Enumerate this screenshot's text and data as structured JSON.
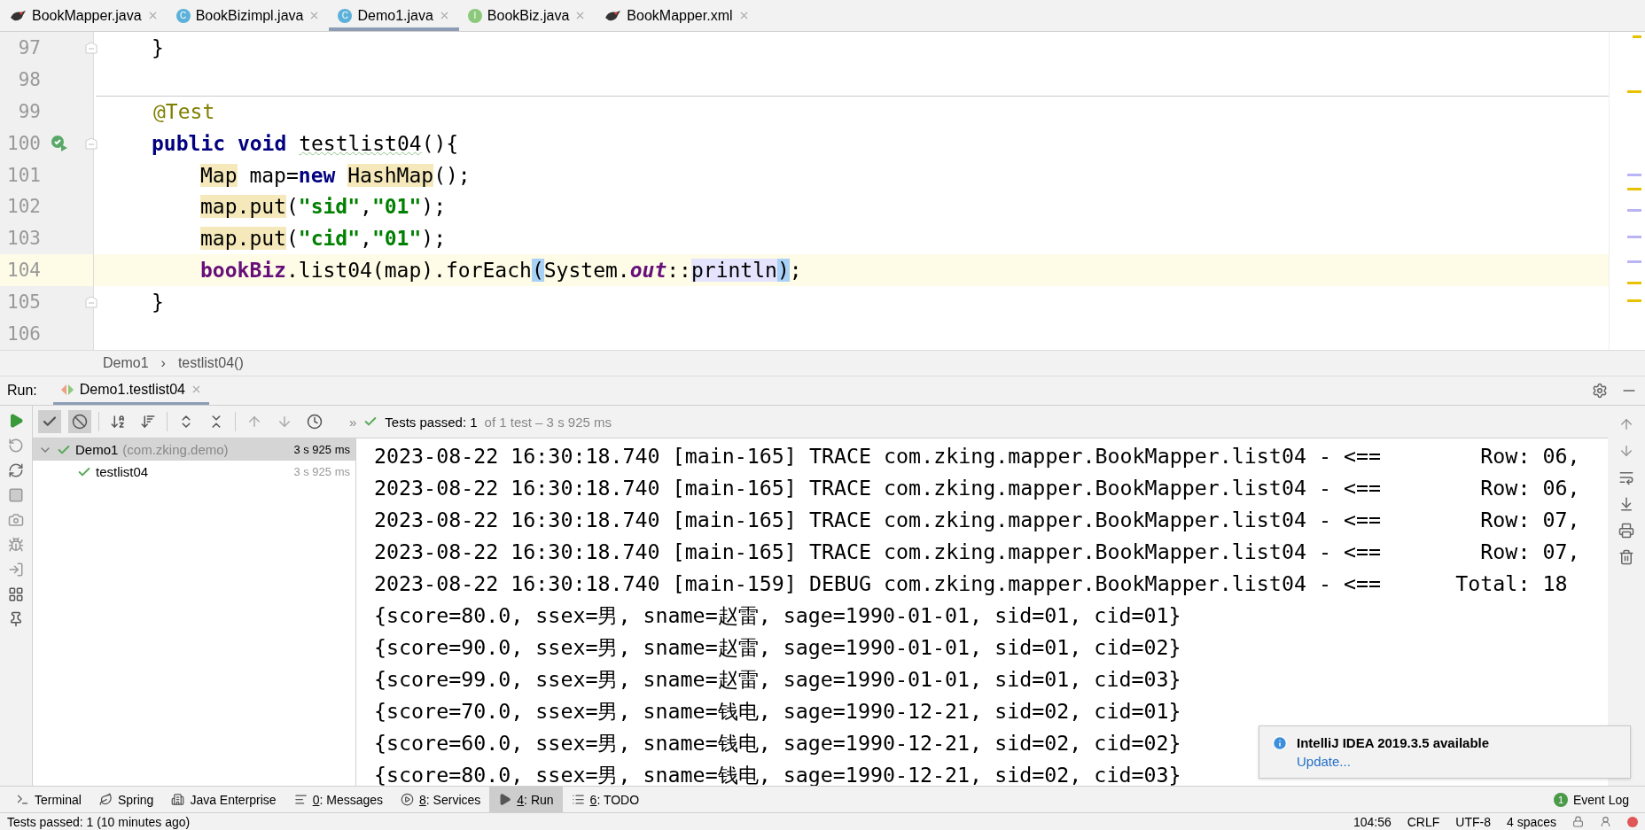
{
  "editor_tabs": [
    {
      "label": "BookMapper.java",
      "kind": "mybatis",
      "selected": false
    },
    {
      "label": "BookBizimpl.java",
      "kind": "class",
      "badge": "C",
      "selected": false
    },
    {
      "label": "Demo1.java",
      "kind": "test_class",
      "badge": "C",
      "selected": true
    },
    {
      "label": "BookBiz.java",
      "kind": "interface",
      "badge": "I",
      "selected": false
    },
    {
      "label": "BookMapper.xml",
      "kind": "mybatis",
      "selected": false
    }
  ],
  "code_lines": [
    {
      "number": "97",
      "kind": "member",
      "fold": true,
      "runnable": false,
      "separator": false,
      "current": false,
      "tokens": [
        {
          "text": "}",
          "kind": "plain"
        }
      ]
    },
    {
      "number": "98",
      "kind": "member",
      "fold": false,
      "runnable": false,
      "separator": false,
      "current": false
    },
    {
      "number": "99",
      "kind": "member",
      "fold": false,
      "runnable": false,
      "separator": true,
      "current": false,
      "tokens": [
        {
          "text": "@Test",
          "kind": "annotation"
        }
      ]
    },
    {
      "number": "100",
      "kind": "member",
      "fold": true,
      "runnable": true,
      "separator": false,
      "current": false,
      "tokens": [
        {
          "text": "public void ",
          "kind": "keyword"
        },
        {
          "text": "testlist04",
          "kind": "warn"
        },
        {
          "text": "(){",
          "kind": "plain"
        }
      ]
    },
    {
      "number": "101",
      "kind": "statement",
      "fold": false,
      "runnable": false,
      "separator": false,
      "current": false,
      "tokens": [
        {
          "text": "Map",
          "kind": "usage"
        },
        {
          "text": " map=",
          "kind": "plain"
        },
        {
          "text": "new ",
          "kind": "keyword"
        },
        {
          "text": "HashMap",
          "kind": "usage"
        },
        {
          "text": "();",
          "kind": "plain"
        }
      ]
    },
    {
      "number": "102",
      "kind": "statement",
      "fold": false,
      "runnable": false,
      "separator": false,
      "current": false,
      "tokens": [
        {
          "text": "map.put",
          "kind": "usage"
        },
        {
          "text": "(",
          "kind": "plain"
        },
        {
          "text": "\"sid\"",
          "kind": "string"
        },
        {
          "text": ",",
          "kind": "plain"
        },
        {
          "text": "\"01\"",
          "kind": "string"
        },
        {
          "text": ");",
          "kind": "plain"
        }
      ]
    },
    {
      "number": "103",
      "kind": "statement",
      "fold": false,
      "runnable": false,
      "separator": false,
      "current": false,
      "tokens": [
        {
          "text": "map.put",
          "kind": "usage"
        },
        {
          "text": "(",
          "kind": "plain"
        },
        {
          "text": "\"cid\"",
          "kind": "string"
        },
        {
          "text": ",",
          "kind": "plain"
        },
        {
          "text": "\"01\"",
          "kind": "string"
        },
        {
          "text": ");",
          "kind": "plain"
        }
      ]
    },
    {
      "number": "104",
      "kind": "statement",
      "fold": false,
      "runnable": false,
      "separator": false,
      "current": true,
      "tokens": [
        {
          "text": "bookBiz",
          "kind": "field"
        },
        {
          "text": ".list04(map).forEach",
          "kind": "plain"
        },
        {
          "text": "(",
          "kind": "brace"
        },
        {
          "text": "System.",
          "kind": "plain"
        },
        {
          "text": "out",
          "kind": "static"
        },
        {
          "text": "::",
          "kind": "plain"
        },
        {
          "text": "println",
          "kind": "ref"
        },
        {
          "text": ")",
          "kind": "brace"
        },
        {
          "text": ";",
          "kind": "plain"
        }
      ]
    },
    {
      "number": "105",
      "kind": "member",
      "fold": true,
      "runnable": false,
      "separator": false,
      "current": false,
      "tokens": [
        {
          "text": "}",
          "kind": "plain"
        }
      ]
    },
    {
      "number": "106",
      "kind": "member",
      "fold": false,
      "runnable": false,
      "separator": false,
      "current": false
    }
  ],
  "breadcrumb": {
    "items": [
      "Demo1",
      "testlist04()"
    ],
    "separator": "›"
  },
  "run": {
    "label": "Run:",
    "tab": {
      "label": "Demo1.testlist04",
      "selected": true
    },
    "filter_toggles": [
      {
        "kind": "passed",
        "on": true
      },
      {
        "kind": "ignored",
        "on": true
      }
    ],
    "overflow": "»",
    "summary": {
      "main": "Tests passed: 1",
      "detail": "of 1 test – 3 s 925 ms"
    },
    "tree": [
      {
        "label": "Demo1",
        "detail": "(com.zking.demo)",
        "time": "3 s 925 ms",
        "selected": true,
        "expanded": true,
        "children": [
          {
            "label": "testlist04",
            "time": "3 s 925 ms",
            "selected": false
          }
        ]
      }
    ],
    "console": [
      "2023-08-22 16:30:18.740 [main-165] TRACE com.zking.mapper.BookMapper.list04 - <==        Row: 06,",
      "2023-08-22 16:30:18.740 [main-165] TRACE com.zking.mapper.BookMapper.list04 - <==        Row: 06,",
      "2023-08-22 16:30:18.740 [main-165] TRACE com.zking.mapper.BookMapper.list04 - <==        Row: 07,",
      "2023-08-22 16:30:18.740 [main-165] TRACE com.zking.mapper.BookMapper.list04 - <==        Row: 07,",
      "2023-08-22 16:30:18.740 [main-159] DEBUG com.zking.mapper.BookMapper.list04 - <==      Total: 18",
      "{score=80.0, ssex=男, sname=赵雷, sage=1990-01-01, sid=01, cid=01}",
      "{score=90.0, ssex=男, sname=赵雷, sage=1990-01-01, sid=01, cid=02}",
      "{score=99.0, ssex=男, sname=赵雷, sage=1990-01-01, sid=01, cid=03}",
      "{score=70.0, ssex=男, sname=钱电, sage=1990-12-21, sid=02, cid=01}",
      "{score=60.0, ssex=男, sname=钱电, sage=1990-12-21, sid=02, cid=02}",
      "{score=80.0, ssex=男, sname=钱电, sage=1990-12-21, sid=02, cid=03}"
    ]
  },
  "notification": {
    "title": "IntelliJ IDEA 2019.3.5 available",
    "link": "Update..."
  },
  "tool_windows": [
    {
      "label": "Terminal",
      "kind": "terminal",
      "mnemonic": false,
      "selected": false
    },
    {
      "label": "Spring",
      "kind": "spring",
      "mnemonic": false,
      "selected": false
    },
    {
      "label": "Java Enterprise",
      "kind": "enterprise",
      "mnemonic": false,
      "selected": false
    },
    {
      "label": "0: Messages",
      "kind": "messages",
      "mnemonic": true,
      "selected": false
    },
    {
      "label": "8: Services",
      "kind": "services",
      "mnemonic": true,
      "selected": false
    },
    {
      "label": "4: Run",
      "kind": "run",
      "mnemonic": true,
      "selected": true
    },
    {
      "label": "6: TODO",
      "kind": "todo",
      "mnemonic": true,
      "selected": false
    }
  ],
  "event_log": {
    "label": "Event Log",
    "count": "1"
  },
  "status_bar": {
    "message": "Tests passed: 1 (10 minutes ago)",
    "items": [
      "104:56",
      "CRLF",
      "UTF-8",
      "4 spaces"
    ]
  }
}
